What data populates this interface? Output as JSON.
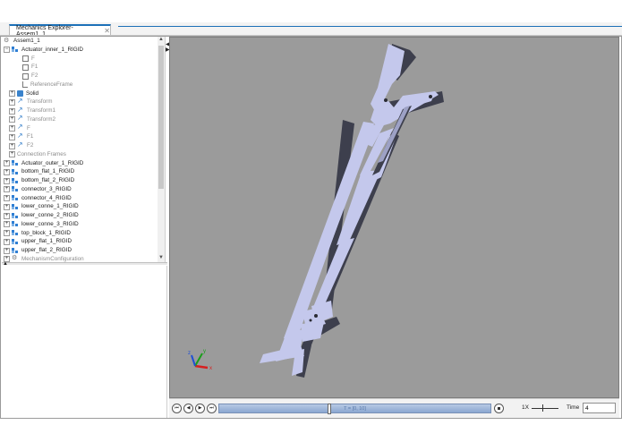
{
  "tab": {
    "title": "Mechanics Explorer-Assem1_1",
    "close": "✕"
  },
  "tree": {
    "root": "Assem1_1",
    "items": [
      {
        "label": "Actuator_inner_1_RIGID",
        "icon": "rigid-body-icon",
        "indent": 1,
        "expander": "⊟",
        "gray": false
      },
      {
        "label": "F",
        "icon": "frame-icon",
        "indent": 3,
        "expander": "",
        "gray": true
      },
      {
        "label": "F1",
        "icon": "frame-icon",
        "indent": 3,
        "expander": "",
        "gray": true
      },
      {
        "label": "F2",
        "icon": "frame-icon",
        "indent": 3,
        "expander": "",
        "gray": true
      },
      {
        "label": "ReferenceFrame",
        "icon": "reference-frame-icon",
        "indent": 3,
        "expander": "",
        "gray": true
      },
      {
        "label": "Solid",
        "icon": "solid-icon",
        "indent": 2,
        "expander": "⊞",
        "gray": false
      },
      {
        "label": "Transform",
        "icon": "transform-icon",
        "indent": 2,
        "expander": "⊞",
        "gray": true
      },
      {
        "label": "Transform1",
        "icon": "transform-icon",
        "indent": 2,
        "expander": "⊞",
        "gray": true
      },
      {
        "label": "Transform2",
        "icon": "transform-icon",
        "indent": 2,
        "expander": "⊞",
        "gray": true
      },
      {
        "label": "F",
        "icon": "transform-icon",
        "indent": 2,
        "expander": "⊞",
        "gray": true
      },
      {
        "label": "F1",
        "icon": "transform-icon",
        "indent": 2,
        "expander": "⊞",
        "gray": true
      },
      {
        "label": "F2",
        "icon": "transform-icon",
        "indent": 2,
        "expander": "⊞",
        "gray": true
      },
      {
        "label": "Connection Frames",
        "icon": "",
        "indent": 2,
        "expander": "⊞",
        "gray": true
      },
      {
        "label": "Actuator_outer_1_RIGID",
        "icon": "rigid-body-icon",
        "indent": 1,
        "expander": "⊞",
        "gray": false
      },
      {
        "label": "bottom_flat_1_RIGID",
        "icon": "rigid-body-icon",
        "indent": 1,
        "expander": "⊞",
        "gray": false
      },
      {
        "label": "bottom_flat_2_RIGID",
        "icon": "rigid-body-icon",
        "indent": 1,
        "expander": "⊞",
        "gray": false
      },
      {
        "label": "connector_3_RIGID",
        "icon": "rigid-body-icon",
        "indent": 1,
        "expander": "⊞",
        "gray": false
      },
      {
        "label": "connector_4_RIGID",
        "icon": "rigid-body-icon",
        "indent": 1,
        "expander": "⊞",
        "gray": false
      },
      {
        "label": "lower_conne_1_RIGID",
        "icon": "rigid-body-icon",
        "indent": 1,
        "expander": "⊞",
        "gray": false
      },
      {
        "label": "lower_conne_2_RIGID",
        "icon": "rigid-body-icon",
        "indent": 1,
        "expander": "⊞",
        "gray": false
      },
      {
        "label": "lower_conne_3_RIGID",
        "icon": "rigid-body-icon",
        "indent": 1,
        "expander": "⊞",
        "gray": false
      },
      {
        "label": "top_block_1_RIGID",
        "icon": "rigid-body-icon",
        "indent": 1,
        "expander": "⊞",
        "gray": false
      },
      {
        "label": "upper_flat_1_RIGID",
        "icon": "rigid-body-icon",
        "indent": 1,
        "expander": "⊞",
        "gray": false
      },
      {
        "label": "upper_flat_2_RIGID",
        "icon": "rigid-body-icon",
        "indent": 1,
        "expander": "⊞",
        "gray": false
      },
      {
        "label": "MechanismConfiguration",
        "icon": "gear-icon",
        "indent": 1,
        "expander": "⊞",
        "gray": true
      }
    ]
  },
  "viewport": {
    "background": "#9b9b9b",
    "model_color": "#c4c8ec",
    "model_shadow": "#3d3f4d",
    "axis_colors": {
      "x": "#d62020",
      "y": "#1a9e1a",
      "z": "#1f4fd6"
    },
    "axis_labels": {
      "x": "x",
      "y": "y",
      "z": "z"
    }
  },
  "playback": {
    "buttons": [
      "⏮",
      "◀",
      "▶",
      "⏭"
    ],
    "timeline_label": "T = [0, 10]",
    "timeline_position": 0.4,
    "speed": "1X",
    "time_label": "Time",
    "time_value": "4"
  }
}
